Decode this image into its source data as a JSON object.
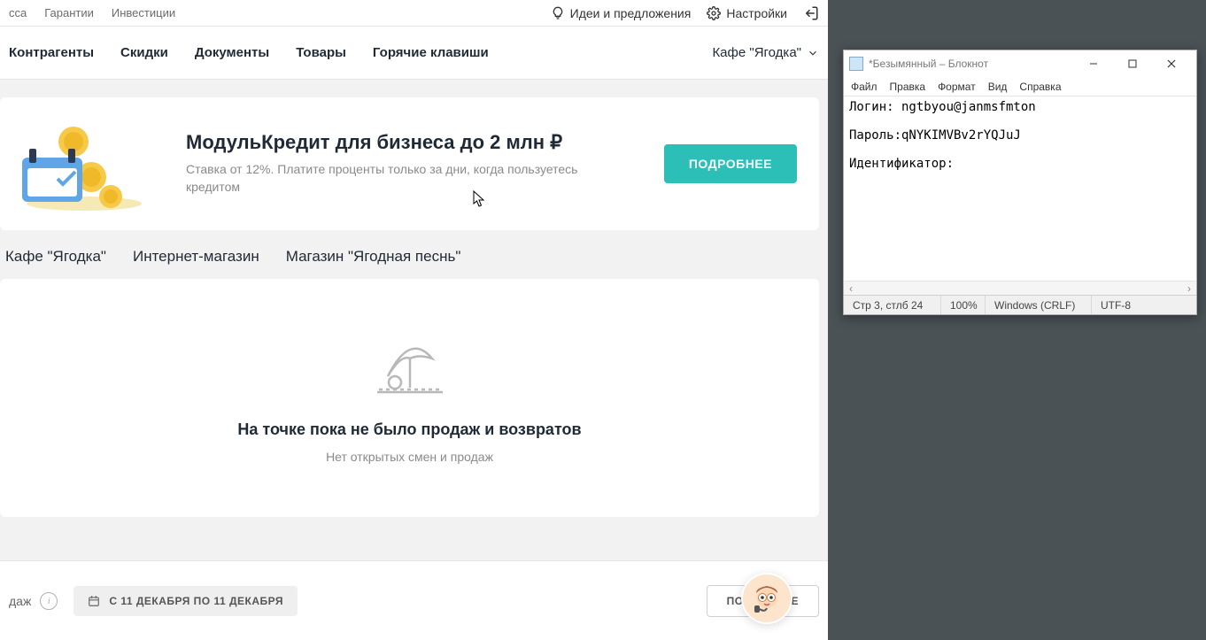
{
  "topbar": {
    "left": [
      "сса",
      "Гарантии",
      "Инвестиции"
    ],
    "ideas": "Идеи и предложения",
    "settings": "Настройки"
  },
  "nav": {
    "items": [
      "Контрагенты",
      "Скидки",
      "Документы",
      "Товары",
      "Горячие клавиши"
    ],
    "company": "Кафе \"Ягодка\""
  },
  "promo": {
    "title": "МодульКредит для бизнеса до 2 млн ₽",
    "sub": "Ставка от 12%. Платите проценты только за дни, когда пользуетесь кредитом",
    "button": "ПОДРОБНЕЕ"
  },
  "tabs": [
    "Кафе \"Ягодка\"",
    "Интернет-магазин",
    "Магазин \"Ягодная песнь\""
  ],
  "empty": {
    "title": "На точке пока не было продаж и возвратов",
    "sub": "Нет открытых смен и продаж"
  },
  "footer": {
    "left_text": "даж",
    "date_chip": "С 11 ДЕКАБРЯ ПО 11 ДЕКАБРЯ",
    "button": "ПОДРОБНЕЕ"
  },
  "notepad": {
    "title": "*Безымянный – Блокнот",
    "menu": [
      "Файл",
      "Правка",
      "Формат",
      "Вид",
      "Справка"
    ],
    "body": "Логин: ngtbyou@janmsfmton\n\nПароль:qNYKIMVBv2rYQJuJ\n\nИдентификатор:",
    "status": {
      "pos": "Стр 3, стлб 24",
      "zoom": "100%",
      "eol": "Windows (CRLF)",
      "enc": "UTF-8"
    }
  }
}
